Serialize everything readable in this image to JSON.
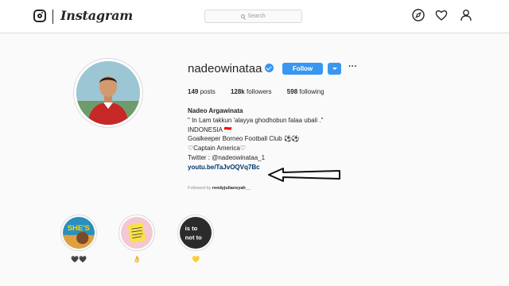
{
  "header": {
    "logo_text": "Instagram",
    "search_placeholder": "Search",
    "icons": [
      "instagram-camera-icon",
      "explore-compass-icon",
      "activity-heart-icon",
      "profile-person-icon"
    ]
  },
  "profile": {
    "username": "nadeowinataa",
    "verified_icon": "verified-badge-icon",
    "follow_label": "Follow",
    "more_label": "···",
    "stats": {
      "posts_count": "149",
      "posts_label": "posts",
      "followers_count": "128k",
      "followers_label": "followers",
      "following_count": "598",
      "following_label": "following"
    },
    "bio": {
      "full_name": "Nadeo Argawinata",
      "line1": "\" In Lam takkun 'alayya ghodhobun falaa ubali .\"",
      "line2": "INDONESIA 🇮🇩",
      "line3": "Goalkeeper Borneo Football Club ⚽⚽",
      "line4": "♡Captain America♡",
      "line5": "Twitter : @nadeowinataa_1",
      "link": "youtu.be/TaJvOQVq7Bc"
    },
    "followed_by_prefix": "Followed by",
    "followed_by_user": "rendyjuliansyah__"
  },
  "highlights": [
    {
      "label": "🖤🖤",
      "cover_text": "SHE'S"
    },
    {
      "label": "👌",
      "cover_text": ""
    },
    {
      "label": "💛",
      "cover_text": "is to\nnot to"
    }
  ],
  "colors": {
    "accent": "#3897f0",
    "link": "#003569",
    "border": "#dbdbdb",
    "background": "#fafafa"
  }
}
